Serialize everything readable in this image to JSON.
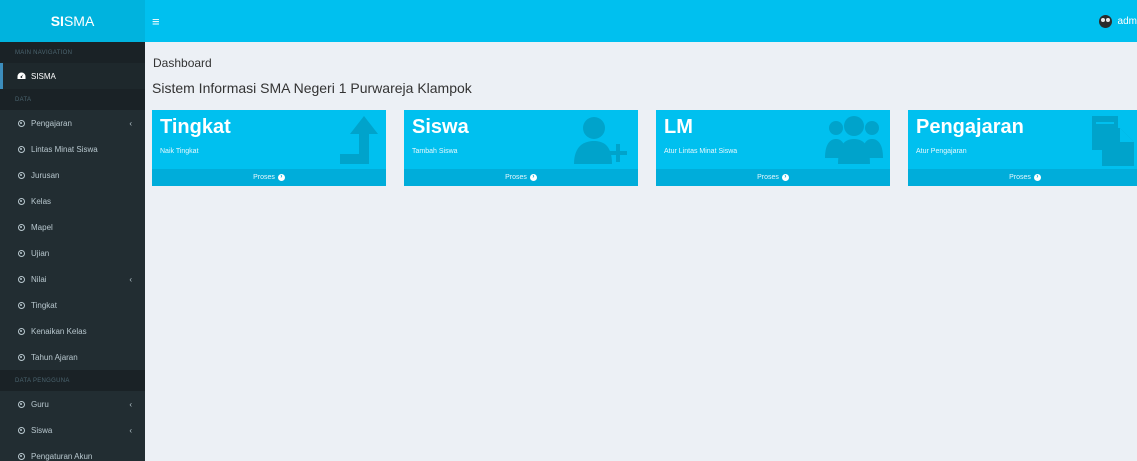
{
  "app": {
    "logo_bold": "SI",
    "logo_rest": "SMA",
    "toggle_icon": "≡",
    "user_name": "adm"
  },
  "sidebar": {
    "sections": [
      {
        "header": "MAIN NAVIGATION"
      },
      {
        "header": "DATA"
      },
      {
        "header": "DATA PENGGUNA"
      }
    ],
    "items": [
      {
        "label": "SISMA",
        "icon": "dashboard-icon",
        "active": true
      },
      {
        "label": "Pengajaran",
        "icon": "circle-icon",
        "chevron": "‹"
      },
      {
        "label": "Lintas Minat Siswa",
        "icon": "circle-icon"
      },
      {
        "label": "Jurusan",
        "icon": "circle-icon"
      },
      {
        "label": "Kelas",
        "icon": "circle-icon"
      },
      {
        "label": "Mapel",
        "icon": "circle-icon"
      },
      {
        "label": "Ujian",
        "icon": "circle-icon"
      },
      {
        "label": "Nilai",
        "icon": "circle-icon",
        "chevron": "‹"
      },
      {
        "label": "Tingkat",
        "icon": "circle-icon"
      },
      {
        "label": "Kenaikan Kelas",
        "icon": "circle-icon"
      },
      {
        "label": "Tahun Ajaran",
        "icon": "circle-icon"
      },
      {
        "label": "Guru",
        "icon": "circle-icon",
        "chevron": "‹"
      },
      {
        "label": "Siswa",
        "icon": "circle-icon",
        "chevron": "‹"
      },
      {
        "label": "Pengaturan Akun",
        "icon": "circle-icon"
      }
    ]
  },
  "main": {
    "breadcrumb": "Dashboard",
    "title": "Sistem Informasi SMA Negeri 1 Purwareja Klampok",
    "boxes": [
      {
        "title": "Tingkat",
        "subtitle": "Naik Tingkat",
        "footer": "Proses",
        "icon": "level-up-arrow-icon"
      },
      {
        "title": "Siswa",
        "subtitle": "Tambah Siswa",
        "footer": "Proses",
        "icon": "user-plus-icon"
      },
      {
        "title": "LM",
        "subtitle": "Atur Lintas Minat Siswa",
        "footer": "Proses",
        "icon": "users-group-icon"
      },
      {
        "title": "Pengajaran",
        "subtitle": "Atur Pengajaran",
        "footer": "Proses",
        "icon": "documents-icon"
      }
    ]
  },
  "colors": {
    "accent": "#00c0ef",
    "logo_bg": "#00b3de",
    "sidebar_bg": "#222d32",
    "content_bg": "#ecf0f5"
  }
}
